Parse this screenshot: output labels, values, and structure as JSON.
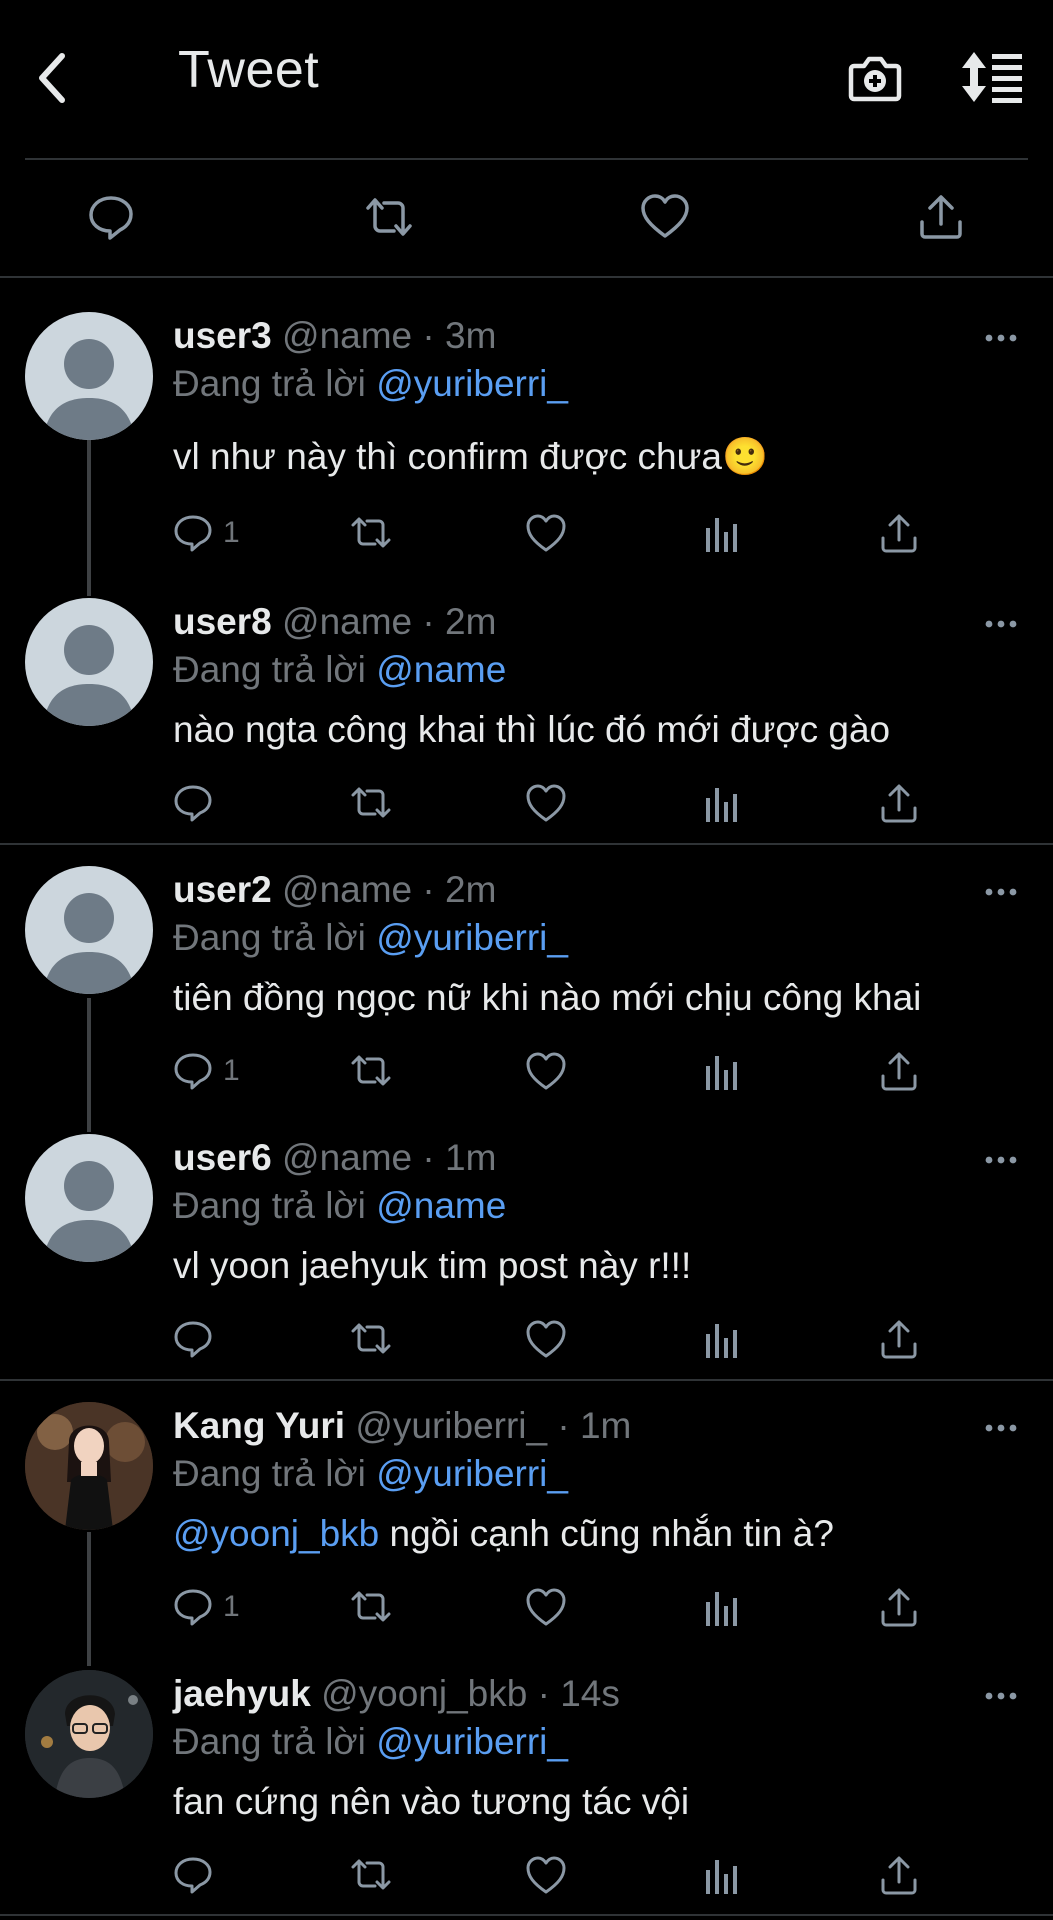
{
  "header": {
    "title": "Tweet"
  },
  "replies": [
    {
      "display_name": "user3",
      "handle": "@name",
      "time": "3m",
      "replying_label": "Đang trả lời",
      "replying_to": "@yuriberri_",
      "mention": "",
      "text": "vl như này thì confirm được chưa🙂",
      "reply_count": "1"
    },
    {
      "display_name": "user8",
      "handle": "@name",
      "time": "2m",
      "replying_label": "Đang trả lời",
      "replying_to": "@name",
      "mention": "",
      "text": "nào ngta công khai thì lúc đó mới được gào",
      "reply_count": ""
    },
    {
      "display_name": "user2",
      "handle": "@name",
      "time": "2m",
      "replying_label": "Đang trả lời",
      "replying_to": "@yuriberri_",
      "mention": "",
      "text": "tiên đồng ngọc nữ khi nào mới chịu công khai",
      "reply_count": "1"
    },
    {
      "display_name": "user6",
      "handle": "@name",
      "time": "1m",
      "replying_label": "Đang trả lời",
      "replying_to": "@name",
      "mention": "",
      "text": "vl yoon jaehyuk tim post này r!!!",
      "reply_count": ""
    },
    {
      "display_name": "Kang Yuri",
      "handle": "@yuriberri_",
      "time": "1m",
      "replying_label": "Đang trả lời",
      "replying_to": "@yuriberri_",
      "mention": "@yoonj_bkb",
      "text": " ngồi cạnh cũng nhắn tin à?",
      "reply_count": "1"
    },
    {
      "display_name": "jaehyuk",
      "handle": "@yoonj_bkb",
      "time": "14s",
      "replying_label": "Đang trả lời",
      "replying_to": "@yuriberri_",
      "mention": "",
      "text": "fan cứng nên vào tương tác vội",
      "reply_count": ""
    }
  ],
  "colors": {
    "background": "#000000",
    "text": "#e7e9ea",
    "muted": "#71767b",
    "link": "#5a9ef2",
    "separator": "#2f3336"
  }
}
